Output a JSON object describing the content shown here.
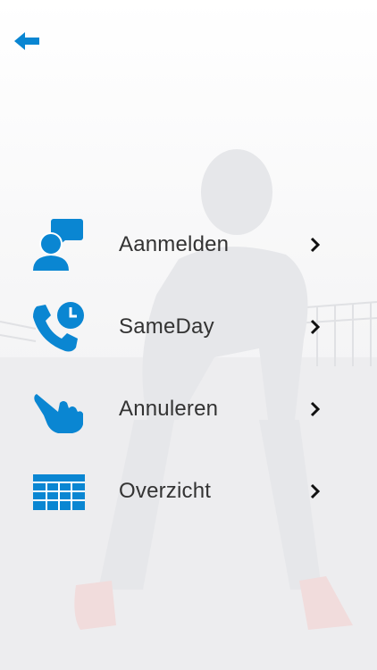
{
  "app": {
    "colors": {
      "accent": "#0a86d2",
      "text": "#333333",
      "chevron": "#111111"
    }
  },
  "header": {
    "back_icon": "back-arrow-icon"
  },
  "menu": {
    "items": [
      {
        "label": "Aanmelden",
        "icon": "user-chat-icon"
      },
      {
        "label": "SameDay",
        "icon": "phone-clock-icon"
      },
      {
        "label": "Annuleren",
        "icon": "hand-swipe-icon"
      },
      {
        "label": "Overzicht",
        "icon": "table-grid-icon"
      }
    ],
    "chevron_icon": "chevron-right-icon"
  }
}
